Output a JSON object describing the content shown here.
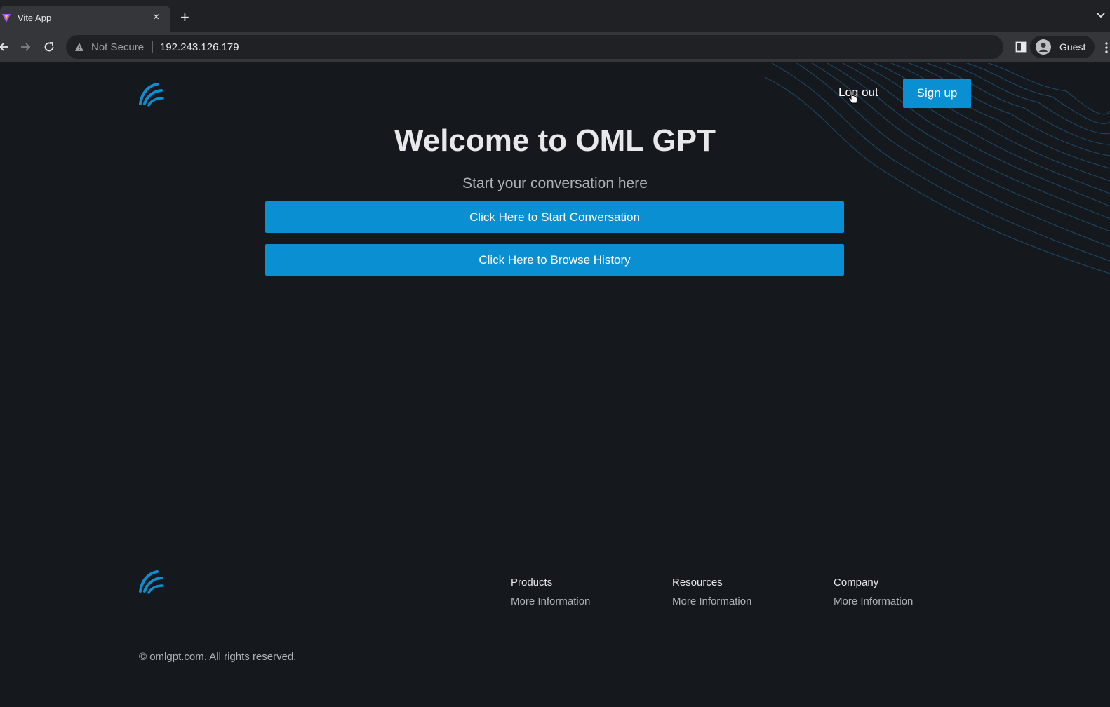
{
  "browser": {
    "tab_title": "Vite App",
    "tab_close": "×",
    "new_tab": "+",
    "security_label": "Not Secure",
    "url": "192.243.126.179",
    "profile_label": "Guest"
  },
  "header": {
    "logout_label": "Log out",
    "signup_label": "Sign up"
  },
  "hero": {
    "title": "Welcome to OML GPT",
    "subtitle": "Start your conversation here",
    "start_button": "Click Here to Start Conversation",
    "history_button": "Click Here to Browse History"
  },
  "footer": {
    "columns": [
      {
        "heading": "Products",
        "link": "More Information"
      },
      {
        "heading": "Resources",
        "link": "More Information"
      },
      {
        "heading": "Company",
        "link": "More Information"
      }
    ],
    "copyright": "© omlgpt.com. All rights reserved."
  },
  "colors": {
    "accent": "#0a8fd3",
    "background": "#15181c"
  }
}
